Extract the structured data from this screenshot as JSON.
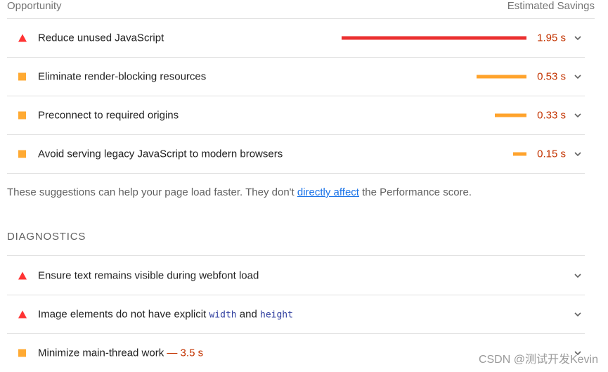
{
  "header": {
    "left_label": "Opportunity",
    "right_label": "Estimated Savings"
  },
  "opportunities": [
    {
      "title": "Reduce unused JavaScript",
      "savings": "1.95 s",
      "severity": "fail",
      "icon": "red-triangle-icon",
      "color": "#eb2f2f"
    },
    {
      "title": "Eliminate render-blocking resources",
      "savings": "0.53 s",
      "severity": "average",
      "icon": "orange-square-icon",
      "color": "#ffa32c"
    },
    {
      "title": "Preconnect to required origins",
      "savings": "0.33 s",
      "severity": "average",
      "icon": "orange-square-icon",
      "color": "#ffa32c"
    },
    {
      "title": "Avoid serving legacy JavaScript to modern browsers",
      "savings": "0.15 s",
      "severity": "average",
      "icon": "orange-square-icon",
      "color": "#ffa32c"
    }
  ],
  "note": {
    "before": "These suggestions can help your page load faster. They don't ",
    "link": "directly affect",
    "after": " the Performance score."
  },
  "diagnostics": {
    "heading": "DIAGNOSTICS",
    "items": [
      {
        "title": "Ensure text remains visible during webfont load",
        "severity": "fail",
        "icon": "red-triangle-icon"
      },
      {
        "title_before": "Image elements do not have explicit ",
        "code1": "width",
        "title_mid": " and ",
        "code2": "height",
        "severity": "fail",
        "icon": "red-triangle-icon"
      },
      {
        "title": "Minimize main-thread work",
        "savings": "— 3.5 s",
        "severity": "average",
        "icon": "orange-square-icon"
      }
    ]
  },
  "watermark": "CSDN @测试开发Kevin"
}
